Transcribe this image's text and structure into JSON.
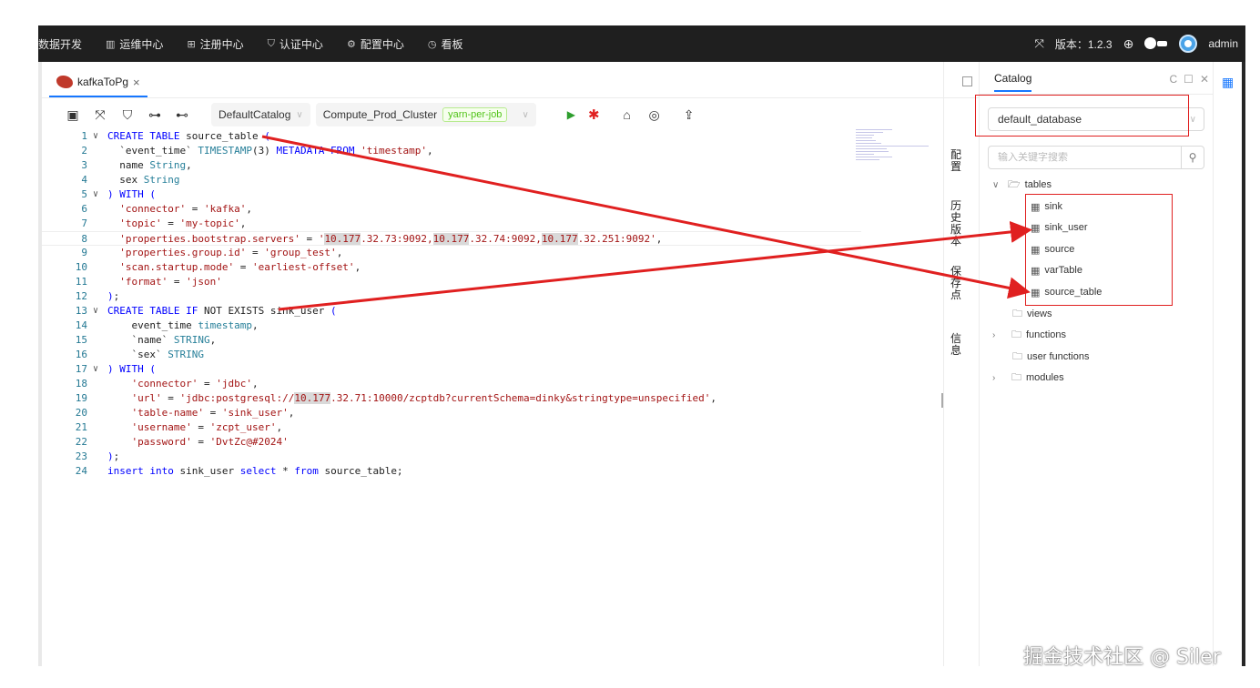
{
  "topnav": {
    "items": [
      {
        "label": "数据开发",
        "icon": ""
      },
      {
        "label": "运维中心",
        "icon": "monitor-icon"
      },
      {
        "label": "注册中心",
        "icon": "grid-icon"
      },
      {
        "label": "认证中心",
        "icon": "shield-icon"
      },
      {
        "label": "配置中心",
        "icon": "gear-icon"
      },
      {
        "label": "看板",
        "icon": "dashboard-icon"
      }
    ],
    "version": "版本：1.2.3",
    "user": "admin"
  },
  "editor_tab": {
    "label": "kafkaToPg",
    "close": "×"
  },
  "toolbar": {
    "catalog_select": "DefaultCatalog",
    "cluster_select": "Compute_Prod_Cluster",
    "cluster_tag": "yarn-per-job"
  },
  "code": {
    "line_numbers": [
      "1",
      "2",
      "3",
      "4",
      "5",
      "6",
      "7",
      "8",
      "9",
      "10",
      "11",
      "12",
      "13",
      "14",
      "15",
      "16",
      "17",
      "18",
      "19",
      "20",
      "21",
      "22",
      "23",
      "24"
    ]
  },
  "side_tabs": [
    "配置",
    "历史版本",
    "保存点",
    "信息"
  ],
  "catalog": {
    "title": "Catalog",
    "database": "default_database",
    "search_placeholder": "输入关键字搜索",
    "tree": {
      "tables": "tables",
      "table_items": [
        "sink",
        "sink_user",
        "source",
        "varTable",
        "source_table"
      ],
      "views": "views",
      "functions": "functions",
      "user_functions": "user functions",
      "modules": "modules"
    }
  },
  "watermark": "掘金技术社区 @ Siler",
  "colors": {
    "accent": "#1677ff",
    "annotation": "#e02020",
    "nav_bg": "#1f1f1f"
  }
}
